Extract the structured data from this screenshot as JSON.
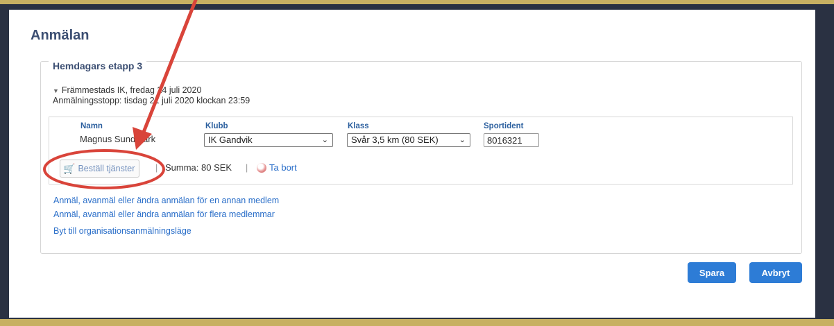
{
  "page": {
    "title": "Anmälan"
  },
  "event": {
    "name": "Hemdagars etapp 3",
    "info_line1": "Främmestads IK, fredag 24 juli 2020",
    "info_line2": "Anmälningsstopp: tisdag 21 juli 2020 klockan 23:59"
  },
  "entry": {
    "columns": {
      "name": "Namn",
      "club": "Klubb",
      "class": "Klass",
      "sportident": "Sportident"
    },
    "person_name": "Magnus Sundmark",
    "club_value": "IK Gandvik",
    "class_value": "Svår 3,5 km (80 SEK)",
    "sportident_value": "8016321",
    "order_services_label": "Beställ tjänster",
    "sum_label": "Summa: 80 SEK",
    "remove_label": "Ta bort",
    "separator": "|"
  },
  "links": [
    {
      "label": "Anmäl, avanmäl eller ändra anmälan för en annan medlem"
    },
    {
      "label": "Anmäl, avanmäl eller ändra anmälan för flera medlemmar"
    },
    {
      "label": "Byt till organisationsanmälningsläge"
    }
  ],
  "actions": {
    "save_label": "Spara",
    "cancel_label": "Avbryt"
  },
  "colors": {
    "accent": "#2d7cd6",
    "heading": "#3c4f73",
    "annotation": "#d9443a"
  }
}
